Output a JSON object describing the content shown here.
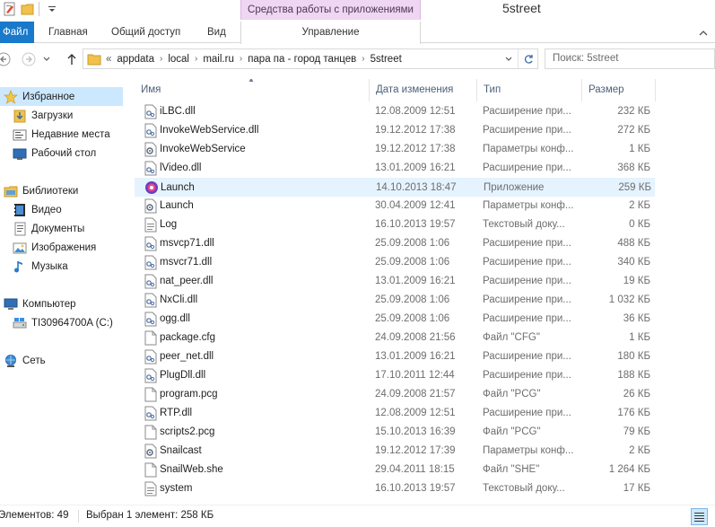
{
  "window": {
    "title": "5street",
    "context_group": "Средства работы с приложениями"
  },
  "ribbon": {
    "tabs": [
      "Файл",
      "Главная",
      "Общий доступ",
      "Вид"
    ],
    "context_tab": "Управление"
  },
  "address": {
    "overflow": "«",
    "crumbs": [
      "appdata",
      "local",
      "mail.ru",
      "пара па - город танцев",
      "5street"
    ],
    "search_placeholder": "Поиск: 5street"
  },
  "nav": {
    "favorites": {
      "label": "Избранное",
      "items": [
        "Загрузки",
        "Недавние места",
        "Рабочий стол"
      ]
    },
    "libraries": {
      "label": "Библиотеки",
      "items": [
        "Видео",
        "Документы",
        "Изображения",
        "Музыка"
      ]
    },
    "computer": {
      "label": "Компьютер",
      "items": [
        "TI30964700A (C:)"
      ]
    },
    "network": {
      "label": "Сеть"
    }
  },
  "columns": {
    "name": "Имя",
    "date": "Дата изменения",
    "type": "Тип",
    "size": "Размер"
  },
  "files": [
    {
      "name": "iLBC.dll",
      "date": "12.08.2009 12:51",
      "type": "Расширение при...",
      "size": "232 КБ",
      "icon": "dll-icon"
    },
    {
      "name": "InvokeWebService.dll",
      "date": "19.12.2012 17:38",
      "type": "Расширение при...",
      "size": "272 КБ",
      "icon": "dll-icon"
    },
    {
      "name": "InvokeWebService",
      "date": "19.12.2012 17:38",
      "type": "Параметры конф...",
      "size": "1 КБ",
      "icon": "config-icon"
    },
    {
      "name": "lVideo.dll",
      "date": "13.01.2009 16:21",
      "type": "Расширение при...",
      "size": "368 КБ",
      "icon": "dll-icon"
    },
    {
      "name": "Launch",
      "date": "14.10.2013 18:47",
      "type": "Приложение",
      "size": "259 КБ",
      "icon": "app-icon"
    },
    {
      "name": "Launch",
      "date": "30.04.2009 12:41",
      "type": "Параметры конф...",
      "size": "2 КБ",
      "icon": "config-icon"
    },
    {
      "name": "Log",
      "date": "16.10.2013 19:57",
      "type": "Текстовый доку...",
      "size": "0 КБ",
      "icon": "text-file-icon"
    },
    {
      "name": "msvcp71.dll",
      "date": "25.09.2008 1:06",
      "type": "Расширение при...",
      "size": "488 КБ",
      "icon": "dll-icon"
    },
    {
      "name": "msvcr71.dll",
      "date": "25.09.2008 1:06",
      "type": "Расширение при...",
      "size": "340 КБ",
      "icon": "dll-icon"
    },
    {
      "name": "nat_peer.dll",
      "date": "13.01.2009 16:21",
      "type": "Расширение при...",
      "size": "19 КБ",
      "icon": "dll-icon"
    },
    {
      "name": "NxCli.dll",
      "date": "25.09.2008 1:06",
      "type": "Расширение при...",
      "size": "1 032 КБ",
      "icon": "dll-icon"
    },
    {
      "name": "ogg.dll",
      "date": "25.09.2008 1:06",
      "type": "Расширение при...",
      "size": "36 КБ",
      "icon": "dll-icon"
    },
    {
      "name": "package.cfg",
      "date": "24.09.2008 21:56",
      "type": "Файл \"CFG\"",
      "size": "1 КБ",
      "icon": "blank-file-icon"
    },
    {
      "name": "peer_net.dll",
      "date": "13.01.2009 16:21",
      "type": "Расширение при...",
      "size": "180 КБ",
      "icon": "dll-icon"
    },
    {
      "name": "PlugDll.dll",
      "date": "17.10.2011 12:44",
      "type": "Расширение при...",
      "size": "188 КБ",
      "icon": "dll-icon"
    },
    {
      "name": "program.pcg",
      "date": "24.09.2008 21:57",
      "type": "Файл \"PCG\"",
      "size": "26 КБ",
      "icon": "blank-file-icon"
    },
    {
      "name": "RTP.dll",
      "date": "12.08.2009 12:51",
      "type": "Расширение при...",
      "size": "176 КБ",
      "icon": "dll-icon"
    },
    {
      "name": "scripts2.pcg",
      "date": "15.10.2013 16:39",
      "type": "Файл \"PCG\"",
      "size": "79 КБ",
      "icon": "blank-file-icon"
    },
    {
      "name": "Snailcast",
      "date": "19.12.2012 17:39",
      "type": "Параметры конф...",
      "size": "2 КБ",
      "icon": "config-icon"
    },
    {
      "name": "SnailWeb.she",
      "date": "29.04.2011 18:15",
      "type": "Файл \"SHE\"",
      "size": "1 264 КБ",
      "icon": "blank-file-icon"
    },
    {
      "name": "system",
      "date": "16.10.2013 19:57",
      "type": "Текстовый доку...",
      "size": "17 КБ",
      "icon": "text-file-icon"
    }
  ],
  "selected_index": 4,
  "status": {
    "count": "Элементов: 49",
    "selection": "Выбран 1 элемент: 258 КБ"
  },
  "colors": {
    "accent": "#1979ca",
    "context": "#efd6f2",
    "selection": "#cce8ff",
    "row_selection": "#e5f3ff"
  }
}
